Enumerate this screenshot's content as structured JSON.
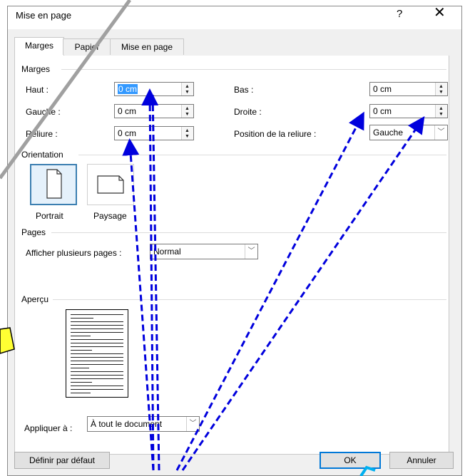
{
  "dialog": {
    "title": "Mise en page",
    "help_label": "?",
    "close_label": "✕"
  },
  "tabs": [
    {
      "label": "Marges",
      "active": true
    },
    {
      "label": "Papier",
      "active": false
    },
    {
      "label": "Mise en page",
      "active": false
    }
  ],
  "margins": {
    "group_label": "Marges",
    "top": {
      "label": "Haut :",
      "value": "0 cm"
    },
    "left": {
      "label": "Gauche :",
      "value": "0 cm"
    },
    "gutter": {
      "label": "Reliure :",
      "value": "0 cm"
    },
    "bottom": {
      "label": "Bas :",
      "value": "0 cm"
    },
    "right": {
      "label": "Droite :",
      "value": "0 cm"
    },
    "gutter_position": {
      "label": "Position de la reliure :",
      "value": "Gauche"
    }
  },
  "orientation": {
    "group_label": "Orientation",
    "portrait_label": "Portrait",
    "landscape_label": "Paysage",
    "selected": "portrait"
  },
  "pages": {
    "group_label": "Pages",
    "multiple_label": "Afficher plusieurs pages :",
    "multiple_value": "Normal"
  },
  "preview": {
    "group_label": "Aperçu"
  },
  "apply": {
    "label": "Appliquer à :",
    "value": "À tout le document"
  },
  "buttons": {
    "default_label": "Définir par défaut",
    "ok_label": "OK",
    "cancel_label": "Annuler"
  },
  "colors": {
    "annotation_arrow": "#0000dd",
    "callout_fill": "#ffff33",
    "accent": "#0078d7",
    "pointer": "#00b0f0"
  }
}
